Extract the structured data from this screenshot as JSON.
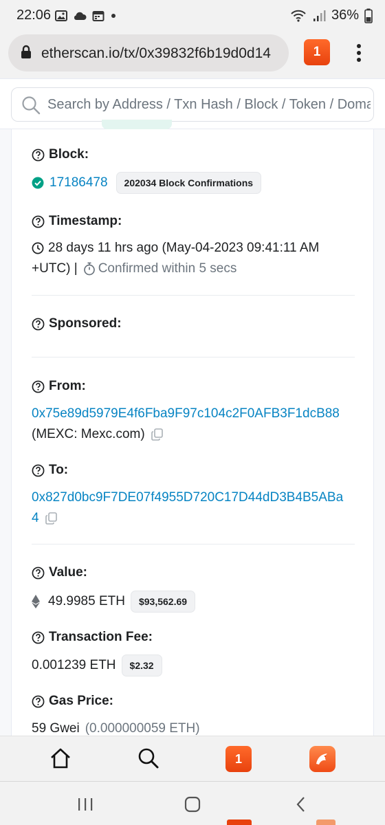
{
  "status_bar": {
    "time": "22:06",
    "battery": "36%",
    "icons": [
      "image-icon",
      "cloud-icon",
      "calendar-icon",
      "dot-icon",
      "wifi-icon",
      "signal-icon",
      "battery-icon"
    ]
  },
  "browser": {
    "url": "etherscan.io/tx/0x39832f6b19d0d14",
    "tab_count": "1"
  },
  "search": {
    "placeholder": "Search by Address / Txn Hash / Block / Token / Domain Name"
  },
  "fields": {
    "block": {
      "label": "Block:",
      "number": "17186478",
      "confirmations": "202034 Block Confirmations"
    },
    "timestamp": {
      "label": "Timestamp:",
      "line1": "28 days 11 hrs ago (May-04-2023 09:41:11 AM",
      "line2": "+UTC) |",
      "confirmed": "Confirmed within 5 secs"
    },
    "sponsored": {
      "label": "Sponsored:"
    },
    "from": {
      "label": "From:",
      "address": "0x75e89d5979E4f6Fba9F97c104c2F0AFB3F1dcB88",
      "name": "(MEXC: Mexc.com)"
    },
    "to": {
      "label": "To:",
      "address_line1": "0x827d0bc9F7DE07f4955D720C17D44dD3B4B5ABa",
      "address_line2": "4"
    },
    "value": {
      "label": "Value:",
      "amount": "49.9985 ETH",
      "usd": "$93,562.69"
    },
    "fee": {
      "label": "Transaction Fee:",
      "amount": "0.001239 ETH",
      "usd": "$2.32"
    },
    "gas": {
      "label": "Gas Price:",
      "gwei": "59 Gwei",
      "eth": "(0.000000059 ETH)"
    }
  },
  "bottom_bar": {
    "tab_count": "1"
  },
  "colors": {
    "link": "#0784c3",
    "accent_orange": "#e8420e",
    "success_green": "#00a186"
  }
}
